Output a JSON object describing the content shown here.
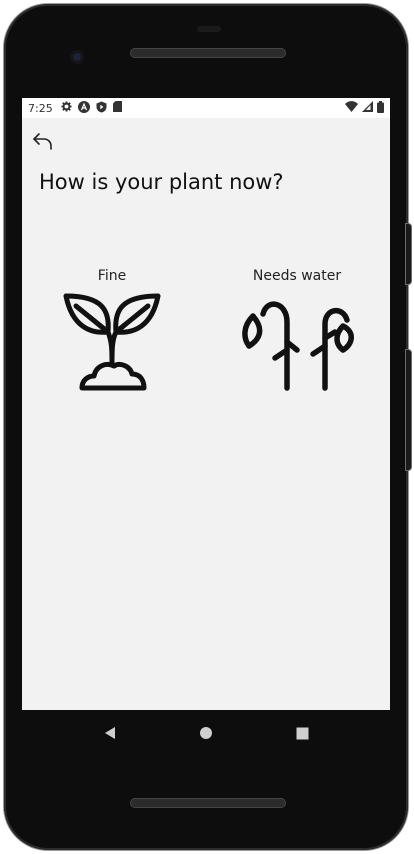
{
  "status_bar": {
    "time": "7:25",
    "left_icons": [
      "gear-icon",
      "a-badge-icon",
      "play-shield-icon",
      "sd-card-icon"
    ],
    "right_icons": [
      "wifi-icon",
      "cell-signal-icon",
      "battery-icon"
    ]
  },
  "header": {
    "back_icon": "undo-arrow-icon",
    "title": "How is your plant now?"
  },
  "options": [
    {
      "label": "Fine",
      "icon": "sprout-icon"
    },
    {
      "label": "Needs water",
      "icon": "wilted-plant-icon"
    }
  ],
  "nav_bar": {
    "buttons": [
      "back-triangle-icon",
      "home-circle-icon",
      "recents-square-icon"
    ]
  },
  "colors": {
    "screen_background": "#f2f2f2",
    "status_bar_background": "#ffffff",
    "icon_stroke": "#111111",
    "device_frame": "#0d0d0d"
  }
}
